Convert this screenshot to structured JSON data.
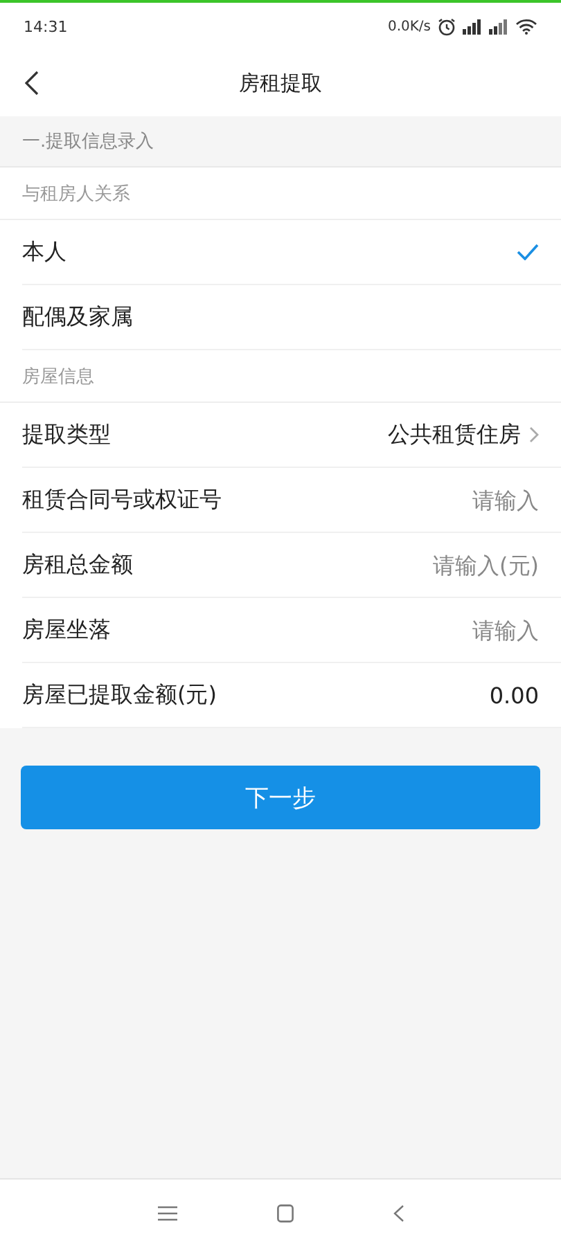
{
  "status_bar": {
    "time": "14:31",
    "speed": "0.0K/s"
  },
  "title": "房租提取",
  "section_header": "一.提取信息录入",
  "relation": {
    "label": "与租房人关系",
    "options": [
      {
        "label": "本人",
        "selected": true
      },
      {
        "label": "配偶及家属",
        "selected": false
      }
    ]
  },
  "house": {
    "label": "房屋信息",
    "rows": [
      {
        "kind": "select",
        "label": "提取类型",
        "value": "公共租赁住房"
      },
      {
        "kind": "input",
        "label": "租赁合同号或权证号",
        "placeholder": "请输入"
      },
      {
        "kind": "input",
        "label": "房租总金额",
        "placeholder": "请输入(元)"
      },
      {
        "kind": "input",
        "label": "房屋坐落",
        "placeholder": "请输入"
      },
      {
        "kind": "value",
        "label": "房屋已提取金额(元)",
        "value": "0.00"
      }
    ]
  },
  "next_button": "下一步"
}
